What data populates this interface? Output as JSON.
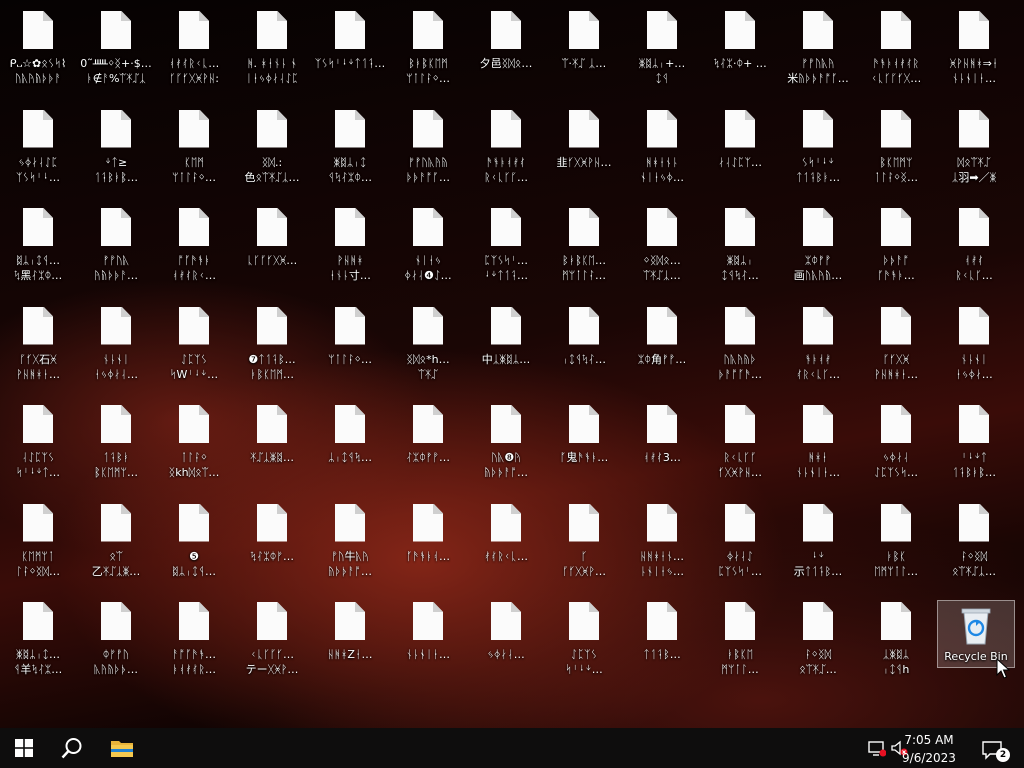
{
  "desktop": {
    "icons": [
      [
        "ᑭ᎑☆✿ᛟᛊᛋ⌇",
        "ᚢᚣᚤᚥᚦᚧᚨ"
      ],
      [
        "0˜ᚊᛜᛝ+·$…",
        "ᚭ∉ᚨ%ᛠᛡᛢᛣ"
      ],
      [
        "ᚮᚯᚰᚱᚲᚳ…",
        "ᚴᚵᚶᚷᚸᚹᚺ:"
      ],
      [
        "ᚻ. ᚼᚽᚾᚿ ᛀ",
        "ᛁᛂᛃᛄᛅᛆᛇᛈ"
      ],
      [
        "ᛉᛊᛋᛌᛍᛎᛏᛐᛑ…",
        ""
      ],
      [
        "ᛒᛓᛔᛕᛖᛗ",
        "ᛘᛙᛚᛛᛜ…"
      ],
      [
        "夕邑ᛝᛞᛟ…",
        ""
      ],
      [
        "ᛠ·ᛡᛢ ᛣ…",
        ""
      ],
      [
        "ᛤᛥᛦᛧ+…",
        "ᛨᛩ"
      ],
      [
        "ᛪᛮᛯ·ᛰ+ …",
        ""
      ],
      [
        "ᚠᚡᚢᚣᚤ",
        "米ᚥᚦᚧᚨᚩᚪ…"
      ],
      [
        "ᚫᚬᚭᚮᚯᚰᚱ",
        "ᚲᚳᚴᚵᚶᚷ…"
      ],
      [
        "ᚸᚹᚺᚻᚼ⇒ᚽ",
        "ᚾᚿᛀᛁᛂ…"
      ],
      [
        "ᛃᛄᛅᛆᛇᛈ",
        "ᛉᛊᛋᛌᛍ…"
      ],
      [
        "ᛎᛏ≥",
        "ᛐᛑᛒᛓᛔ…"
      ],
      [
        "ᛕᛖᛗ",
        "ᛘᛙᛚᛛᛜ…"
      ],
      [
        "ᛝᛞ.:",
        "色ᛟᛠᛡᛢᛣ…"
      ],
      [
        "ᛤᛥᛦᛧᛨ",
        "ᛩᛪᛮᛯᛰ…"
      ],
      [
        "ᚠᚡᚢᚣᚤᚥ",
        "ᚦᚧᚨᚩᚪ…"
      ],
      [
        "ᚫᚬᚭᚮᚯᚰ",
        "ᚱᚲᚳᚴᚵ…"
      ],
      [
        "韭ᚶᚷᚸᚹᚺ…",
        ""
      ],
      [
        "ᚻᚼᚽᚾᚿ",
        "ᛀᛁᛂᛃᛄ…"
      ],
      [
        "ᛅᛆᛇᛈᛉ…",
        ""
      ],
      [
        "ᛊᛋᛌᛍᛎ",
        "ᛏᛐᛑᛒᛓ…"
      ],
      [
        "ᛔᛕᛖᛗᛘ",
        "ᛙᛚᛛᛜᛝ…"
      ],
      [
        "ᛞᛟᛠᛡᛢ",
        "ᛣ羽➡／ᛤ"
      ],
      [
        "ᛥᛦᛧᛨᛩ…",
        "ᛪ黑ᛮᛯᛰ…"
      ],
      [
        "ᚠᚡᚢᚣ",
        "ᚤᚥᚦᚧᚨ…"
      ],
      [
        "ᚩᚪᚫᚬᚭ",
        "ᚮᚯᚰᚱᚲ…"
      ],
      [
        "ᚳᚴᚵᚶᚷᚸ…",
        ""
      ],
      [
        "ᚹᚺᚻᚼ",
        "ᚽᚾᚿ寸…"
      ],
      [
        "ᛀᛁᛂᛃ",
        "ᛄᛅᛆ❹ᛇ…"
      ],
      [
        "ᛈᛉᛊᛋᛌ…",
        "ᛍᛎᛏᛐᛑ…"
      ],
      [
        "ᛒᛓᛔᛕᛖ…",
        "ᛗᛘᛙᛚᛛ…"
      ],
      [
        "ᛜᛝᛞᛟ…",
        "ᛠᛡᛢᛣ…"
      ],
      [
        "ᛤᛥᛦᛧ",
        "ᛨᛩᛪᛮ…"
      ],
      [
        "ᛯᛰᚠᚡ",
        "画ᚢᚣᚤᚥ…"
      ],
      [
        "ᚦᚧᚨᚩ",
        "ᚪᚫᚬᚭ…"
      ],
      [
        "ᚮᚯᚰ",
        "ᚱᚲᚳᚴ…"
      ],
      [
        "ᚵᚶᚷ石ᚸ",
        "ᚹᚺᚻᚼᚽ…"
      ],
      [
        "ᚾᚿᛀᛁ",
        "ᛂᛃᛄᛅᛆ…"
      ],
      [
        "ᛇᛈᛉᛊ",
        "ᛋWᛌᛍᛎ…"
      ],
      [
        "❼ᛏᛐᛑᛒ…",
        "ᛓᛔᛕᛖᛗ…"
      ],
      [
        "ᛘᛙᛚᛛᛜ…",
        ""
      ],
      [
        "ᛝᛞᛟ*h…",
        "ᛠᛡᛢ"
      ],
      [
        "中ᛣᛤᛥᛦ…",
        ""
      ],
      [
        "ᛧᛨᛩᛪᛮ…",
        ""
      ],
      [
        "ᛯᛰ角ᚠᚡ…",
        ""
      ],
      [
        "ᚢᚣᚤᚥᚦ",
        "ᚧᚨᚩᚪᚫ…"
      ],
      [
        "ᚬᚭᚮᚯ",
        "ᚰᚱᚲᚳᚴ…"
      ],
      [
        "ᚵᚶᚷᚸ",
        "ᚹᚺᚻᚼᚽ…"
      ],
      [
        "ᚾᚿᛀᛁ",
        "ᛂᛃᛄᛅ…"
      ],
      [
        "ᛆᛇᛈᛉᛊ",
        "ᛋᛌᛍᛎᛏ…"
      ],
      [
        "ᛐᛑᛒᛓ",
        "ᛔᛕᛖᛗᛘ…"
      ],
      [
        "ᛙᛚᛛᛜ",
        "ᛝkhᛞᛟᛠ…"
      ],
      [
        "ᛡᛢᛣᛤᛥ…",
        ""
      ],
      [
        "ᛦᛧᛨᛩᛪ…",
        ""
      ],
      [
        "ᛮᛯᛰᚠᚡ…",
        ""
      ],
      [
        "ᚢᚣ❽ᚤ",
        "ᚥᚦᚧᚨᚩ…"
      ],
      [
        "ᚪ鬼ᚫᚬᚭ…",
        ""
      ],
      [
        "ᚮᚯᚰ3…",
        ""
      ],
      [
        "ᚱᚲᚳᚴᚵ",
        "ᚶᚷᚸᚹᚺ…"
      ],
      [
        "ᚻᚼᚽ",
        "ᚾᚿᛀᛁᛂ…"
      ],
      [
        "ᛃᛄᛅᛆ",
        "ᛇᛈᛉᛊᛋ…"
      ],
      [
        "ᛌᛍᛎᛏ",
        "ᛐᛑᛒᛓᛔ…"
      ],
      [
        "ᛕᛖᛗᛘᛙ",
        "ᛚᛛᛜᛝᛞ…"
      ],
      [
        "ᛟᛠ",
        "乙ᛡᛢᛣᛤ…"
      ],
      [
        "❺",
        "ᛥᛦᛧᛨᛩ…"
      ],
      [
        "ᛪᛮᛯᛰᚠ…",
        ""
      ],
      [
        "ᚡᚢ牛ᚣᚤ",
        "ᚥᚦᚧᚨᚩ…"
      ],
      [
        "ᚪᚫᚬᚭᚮ…",
        ""
      ],
      [
        "ᚯᚰᚱᚲᚳ…",
        ""
      ],
      [
        "ᚴ",
        "ᚵᚶᚷᚸᚹ…"
      ],
      [
        "ᚺᚻᚼᚽᚾ…",
        "ᚿᛀᛁᛂᛃ…"
      ],
      [
        "ᛄᛅᛆᛇ",
        "ᛈᛉᛊᛋᛌ…"
      ],
      [
        "ᛍᛎ",
        "示ᛏᛐᛑᛒ…"
      ],
      [
        "ᛓᛔᛕ",
        "ᛖᛗᛘᛙᛚ…"
      ],
      [
        "ᛛᛜᛝᛞ",
        "ᛟᛠᛡᛢᛣ…"
      ],
      [
        "ᛤᛥᛦᛧᛨ…",
        "ᛩ羊ᛪᛮᛯ…"
      ],
      [
        "ᛰᚠᚡᚢ",
        "ᚣᚤᚥᚦᚧ…"
      ],
      [
        "ᚨᚩᚪᚫᚬ…",
        "ᚭᚮᚯᚰᚱ…"
      ],
      [
        "ᚲᚳᚴᚵᚶ…",
        "テーᚷᚸᚹ…"
      ],
      [
        "ᚺᚻᚼZᚽ…",
        ""
      ],
      [
        "ᚾᚿᛀᛁᛂ…",
        ""
      ],
      [
        "ᛃᛄᛅᛆ…",
        ""
      ],
      [
        "ᛇᛈᛉᛊ",
        "ᛋᛌᛍᛎ…"
      ],
      [
        "ᛏᛐᛑᛒ…",
        ""
      ],
      [
        "ᛓᛔᛕᛖ",
        "ᛗᛘᛙᛚ…"
      ],
      [
        "ᛛᛜᛝᛞ",
        "ᛟᛠᛡᛢ…"
      ],
      [
        "ᛣᛤᛥᛦ",
        "ᛧᛨᛩh"
      ]
    ],
    "recycle_bin": {
      "label": "Recycle Bin",
      "icon": "recycle-bin-icon"
    }
  },
  "taskbar": {
    "start_icon": "windows-logo-icon",
    "search_icon": "search-icon",
    "pinned": [
      {
        "name": "File Explorer",
        "icon": "folder-icon"
      }
    ],
    "tray": {
      "network_icon": "network-disconnected-icon",
      "volume_icon": "volume-muted-icon",
      "time": "7:05 AM",
      "date": "9/6/2023",
      "notifications_count": "2",
      "notifications_icon": "action-center-icon"
    }
  },
  "colors": {
    "taskbar": "#0e0d0d",
    "label_text": "#ffffff",
    "muted_red": "#e81123"
  }
}
